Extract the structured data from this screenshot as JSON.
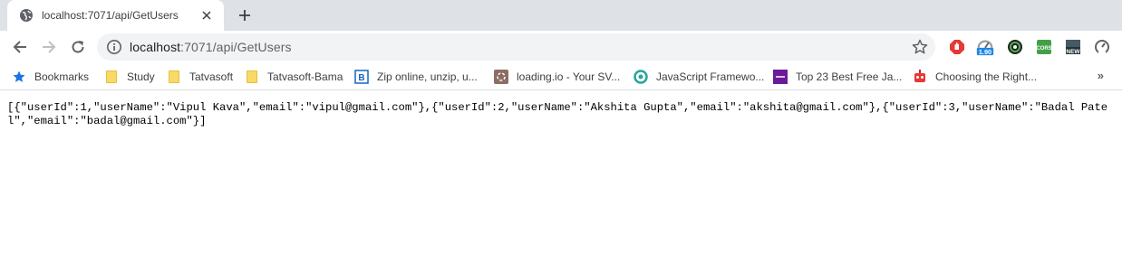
{
  "tab": {
    "title": "localhost:7071/api/GetUsers",
    "favicon": "globe-icon"
  },
  "toolbar": {
    "url_host": "localhost",
    "url_path": ":7071/api/GetUsers",
    "extensions": [
      {
        "name": "adblock-icon",
        "badge": ""
      },
      {
        "name": "speedtest-icon",
        "badge": "1.90"
      },
      {
        "name": "color-picker-icon",
        "badge": ""
      },
      {
        "name": "cors-icon",
        "badge": "CORS"
      },
      {
        "name": "whats-new-icon",
        "badge": "NEW"
      },
      {
        "name": "performance-icon",
        "badge": ""
      }
    ]
  },
  "bookmarks": {
    "items": [
      {
        "label": "Bookmarks",
        "icon": "star-icon"
      },
      {
        "label": "Study",
        "icon": "folder-icon"
      },
      {
        "label": "Tatvasoft",
        "icon": "folder-icon"
      },
      {
        "label": "Tatvasoft-Bama",
        "icon": "folder-icon"
      },
      {
        "label": "Zip online, unzip, u...",
        "icon": "zip-icon"
      },
      {
        "label": "loading.io - Your SV...",
        "icon": "loading-icon"
      },
      {
        "label": "JavaScript Framewo...",
        "icon": "js-framework-icon"
      },
      {
        "label": "Top 23 Best Free Ja...",
        "icon": "colorlib-icon"
      },
      {
        "label": "Choosing the Right...",
        "icon": "robot-icon"
      }
    ],
    "overflow": "»"
  },
  "page": {
    "json_text": "[{\"userId\":1,\"userName\":\"Vipul Kava\",\"email\":\"vipul@gmail.com\"},{\"userId\":2,\"userName\":\"Akshita Gupta\",\"email\":\"akshita@gmail.com\"},{\"userId\":3,\"userName\":\"Badal Patel\",\"email\":\"badal@gmail.com\"}]"
  }
}
